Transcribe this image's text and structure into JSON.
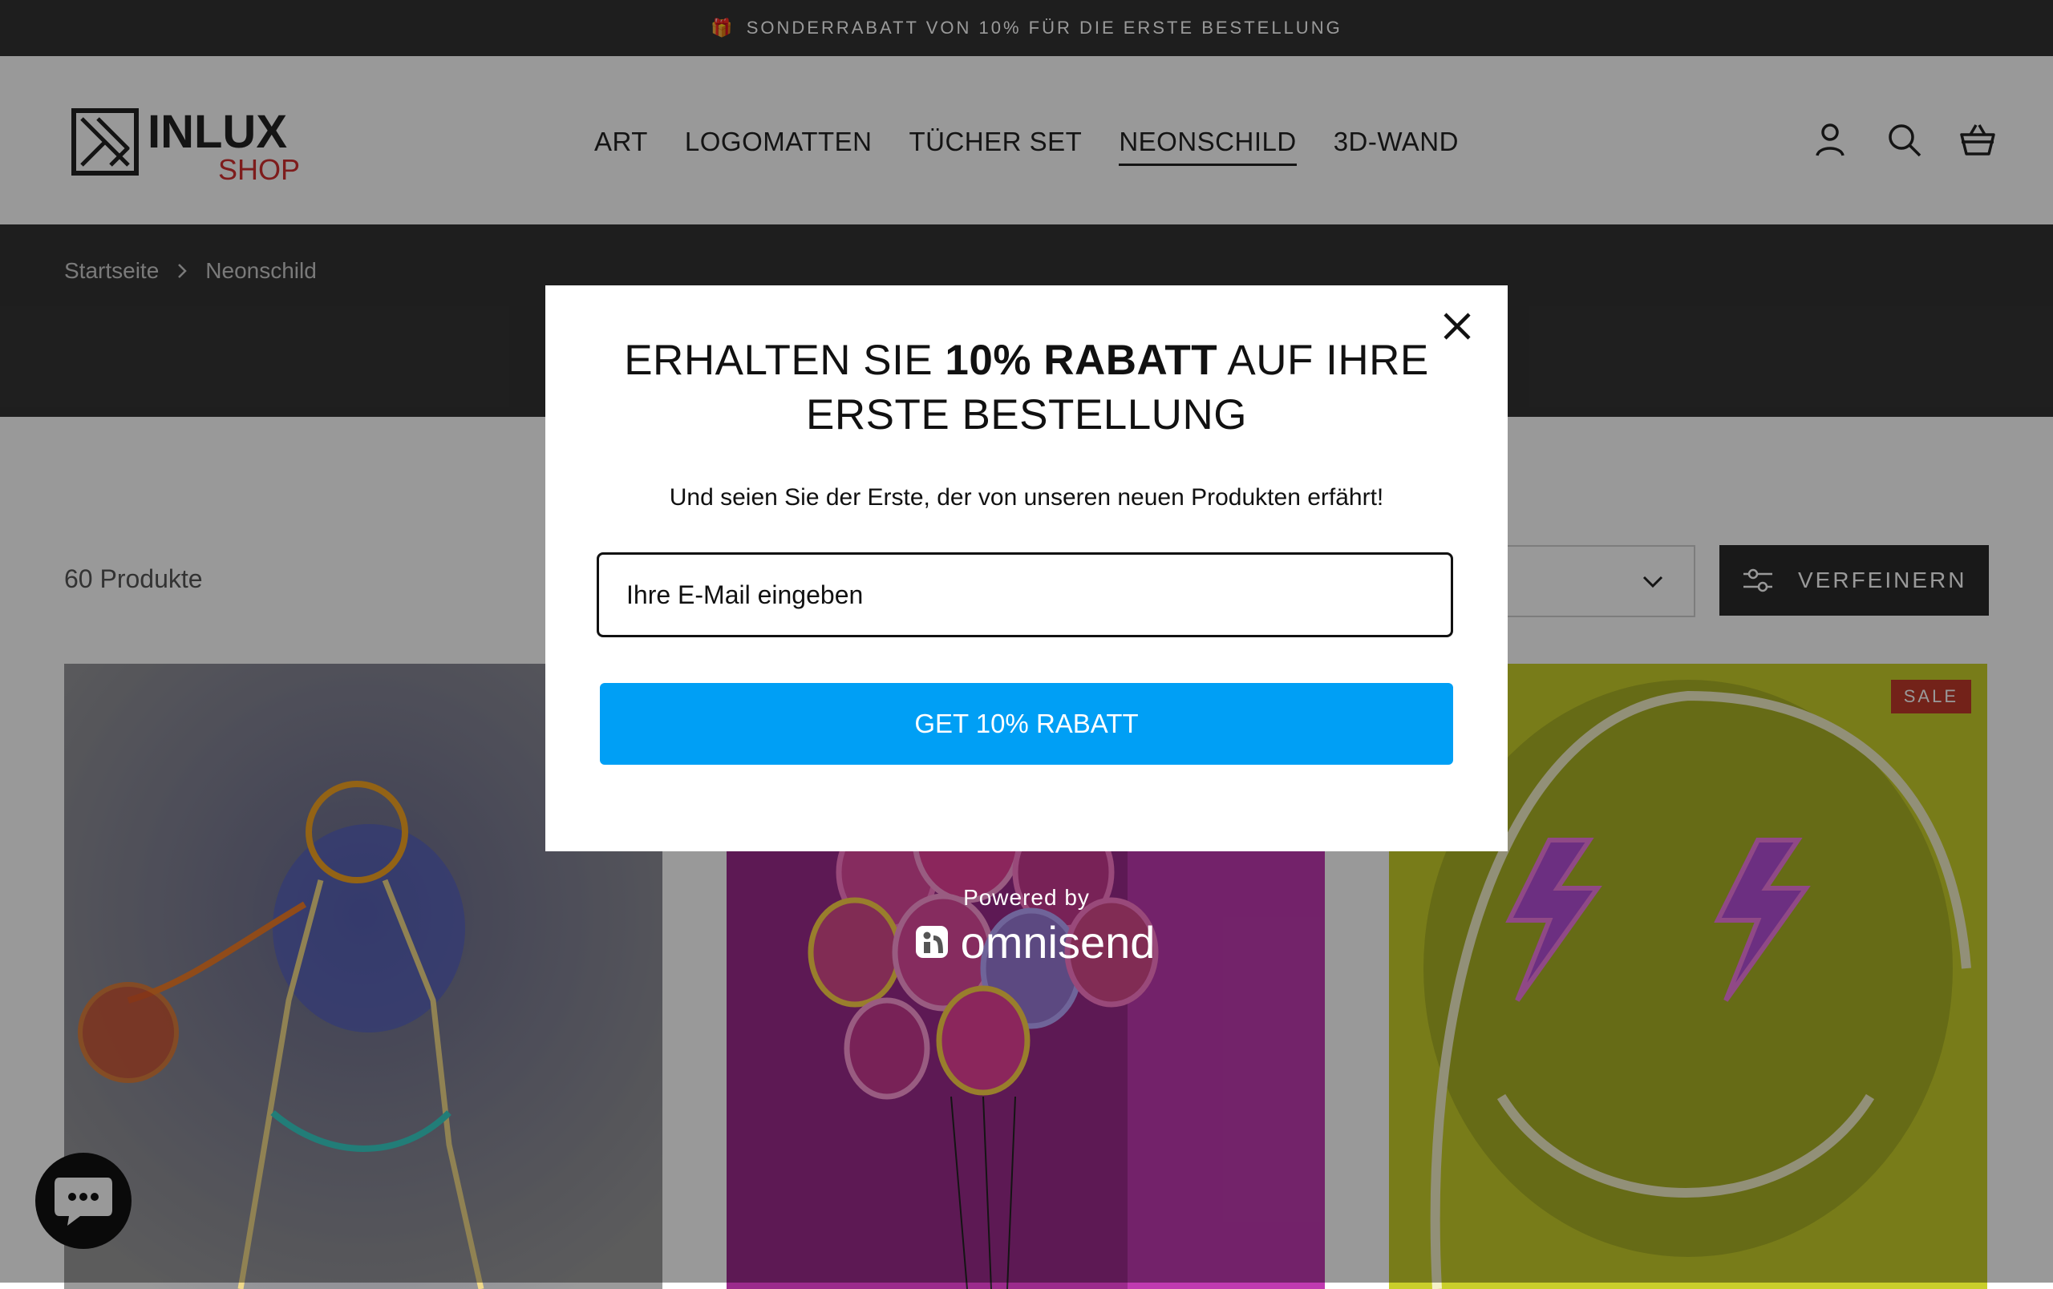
{
  "announcement": {
    "icon": "gift-icon",
    "text": "SONDERRABATT VON 10% FÜR DIE ERSTE BESTELLUNG"
  },
  "header": {
    "logo": {
      "name": "INLUX",
      "sub": "SHOP"
    },
    "nav": [
      {
        "label": "ART"
      },
      {
        "label": "LOGOMATTEN"
      },
      {
        "label": "TÜCHER SET"
      },
      {
        "label": "NEONSCHILD",
        "active": true
      },
      {
        "label": "3D-WAND"
      }
    ],
    "icons": [
      "account-icon",
      "search-icon",
      "cart-icon"
    ]
  },
  "breadcrumb": {
    "home": "Startseite",
    "current": "Neonschild"
  },
  "collection": {
    "count": "60 Produkte",
    "refine_label": "VERFEINERN"
  },
  "products": [
    {
      "image": "basketball-player-neon"
    },
    {
      "image": "balloons-neon"
    },
    {
      "image": "smiley-lightning-neon",
      "badge": "SALE"
    }
  ],
  "popup": {
    "title_prefix": "ERHALTEN SIE",
    "title_bold": "10% RABATT",
    "title_suffix": "AUF IHRE ERSTE BESTELLUNG",
    "subtitle": "Und seien Sie der Erste, der von unseren neuen Produkten erfährt!",
    "email_placeholder": "Ihre E-Mail eingeben",
    "cta": "GET 10% RABATT",
    "powered_by": "Powered by",
    "brand": "omnisend"
  },
  "colors": {
    "cta": "#009ff5",
    "sale": "#c0392b",
    "dark": "#333333"
  }
}
